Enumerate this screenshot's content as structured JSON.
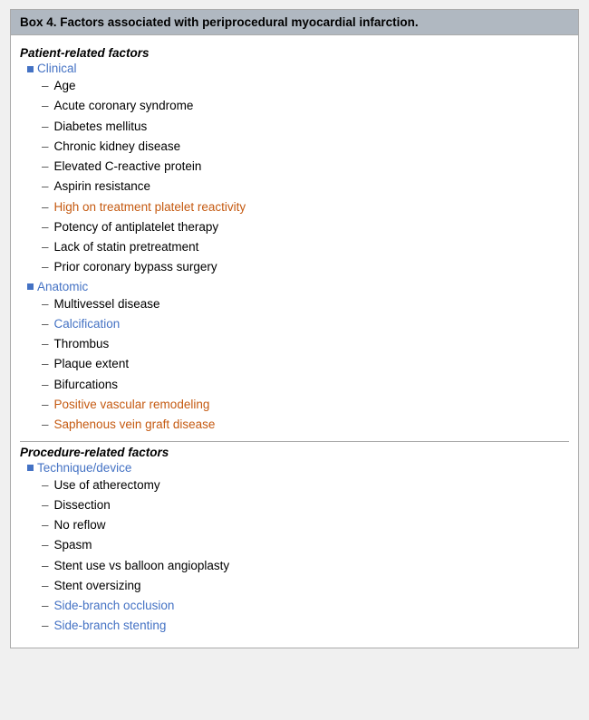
{
  "header": {
    "title": "Box 4. Factors associated with periprocedural myocardial infarction."
  },
  "sections": [
    {
      "id": "patient-related",
      "title": "Patient-related factors",
      "subsections": [
        {
          "id": "clinical",
          "label": "Clinical",
          "items": [
            {
              "text": "Age",
              "color": "normal"
            },
            {
              "text": "Acute coronary syndrome",
              "color": "normal"
            },
            {
              "text": "Diabetes mellitus",
              "color": "normal"
            },
            {
              "text": "Chronic kidney disease",
              "color": "normal"
            },
            {
              "text": "Elevated C-reactive protein",
              "color": "normal"
            },
            {
              "text": "Aspirin resistance",
              "color": "normal"
            },
            {
              "text": "High on treatment platelet reactivity",
              "color": "orange"
            },
            {
              "text": "Potency of antiplatelet therapy",
              "color": "normal"
            },
            {
              "text": "Lack of statin pretreatment",
              "color": "normal"
            },
            {
              "text": "Prior coronary bypass surgery",
              "color": "normal"
            }
          ]
        },
        {
          "id": "anatomic",
          "label": "Anatomic",
          "items": [
            {
              "text": "Multivessel disease",
              "color": "normal"
            },
            {
              "text": "Calcification",
              "color": "blue"
            },
            {
              "text": "Thrombus",
              "color": "normal"
            },
            {
              "text": "Plaque extent",
              "color": "normal"
            },
            {
              "text": "Bifurcations",
              "color": "normal"
            },
            {
              "text": "Positive vascular remodeling",
              "color": "orange"
            },
            {
              "text": "Saphenous vein graft disease",
              "color": "orange"
            }
          ]
        }
      ]
    },
    {
      "id": "procedure-related",
      "title": "Procedure-related factors",
      "subsections": [
        {
          "id": "technique",
          "label": "Technique/device",
          "items": [
            {
              "text": "Use of atherectomy",
              "color": "normal"
            },
            {
              "text": "Dissection",
              "color": "normal"
            },
            {
              "text": "No reflow",
              "color": "normal"
            },
            {
              "text": "Spasm",
              "color": "normal"
            },
            {
              "text": "Stent use vs balloon angioplasty",
              "color": "normal"
            },
            {
              "text": "Stent oversizing",
              "color": "normal"
            },
            {
              "text": "Side-branch occlusion",
              "color": "blue"
            },
            {
              "text": "Side-branch stenting",
              "color": "blue"
            }
          ]
        }
      ]
    }
  ]
}
